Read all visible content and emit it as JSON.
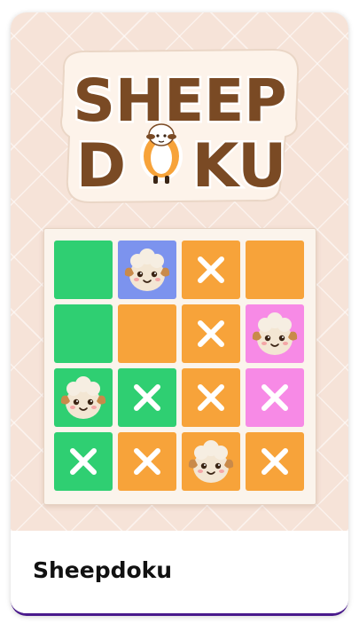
{
  "logo": {
    "line1": "SHEEP",
    "line2_left": "D",
    "line2_right": "KU",
    "text_color": "#7a4a24",
    "outline_color": "#ffffff",
    "plate_color": "#fdf3ea"
  },
  "board": {
    "cells": [
      {
        "color": "#2fcf72",
        "state": "empty"
      },
      {
        "color": "#7c93ee",
        "state": "sheep"
      },
      {
        "color": "#f7a33a",
        "state": "x"
      },
      {
        "color": "#f7a33a",
        "state": "empty"
      },
      {
        "color": "#2fcf72",
        "state": "empty"
      },
      {
        "color": "#f7a33a",
        "state": "empty"
      },
      {
        "color": "#f7a33a",
        "state": "x"
      },
      {
        "color": "#f78ae6",
        "state": "sheep"
      },
      {
        "color": "#2fcf72",
        "state": "sheep"
      },
      {
        "color": "#2fcf72",
        "state": "x"
      },
      {
        "color": "#f7a33a",
        "state": "x"
      },
      {
        "color": "#f78ae6",
        "state": "x"
      },
      {
        "color": "#2fcf72",
        "state": "x"
      },
      {
        "color": "#f7a33a",
        "state": "x"
      },
      {
        "color": "#f7a33a",
        "state": "sheep"
      },
      {
        "color": "#f7a33a",
        "state": "x"
      }
    ]
  },
  "card": {
    "title": "Sheepdoku",
    "accent_color": "#4a1a8c"
  }
}
